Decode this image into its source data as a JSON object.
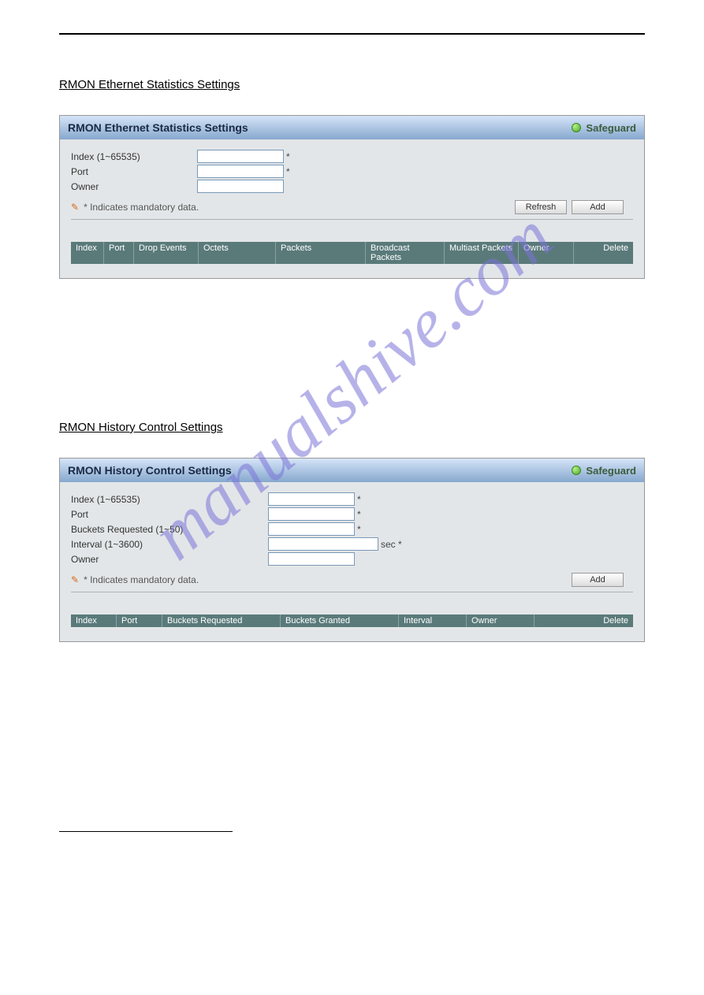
{
  "watermark": "manualshive.com",
  "section1": {
    "title": "RMON Ethernet Statistics Settings",
    "panel_title_pre": "RM",
    "panel_title_post": "ON Ethernet Statistics Settings",
    "safeguard": "Safeguard",
    "fields": {
      "index_label": "Index (1~65535)",
      "port_label": "Port",
      "owner_label": "Owner"
    },
    "star": "*",
    "mandatory": "* Indicates mandatory data.",
    "buttons": {
      "refresh": "Refresh",
      "add": "Add"
    },
    "columns": [
      "Index",
      "Port",
      "Drop Events",
      "Octets",
      "Packets",
      "Broadcast Packets",
      "Multiast Packets",
      "Owner",
      "Delete"
    ]
  },
  "section2": {
    "title": "RMON History Control Settings",
    "panel_title": "RMON History Control Settings",
    "safeguard": "Safeguard",
    "fields": {
      "index_label": "Index (1~65535)",
      "port_label": "Port",
      "buckets_label": "Buckets Requested (1~50)",
      "interval_label": "Interval (1~3600)",
      "interval_suffix": "sec *",
      "owner_label": "Owner"
    },
    "star": "*",
    "mandatory": "* Indicates mandatory data.",
    "buttons": {
      "add": "Add"
    },
    "columns": [
      "Index",
      "Port",
      "Buckets Requested",
      "Buckets Granted",
      "Interval",
      "Owner",
      "Delete"
    ]
  },
  "section3": {
    "title": ""
  }
}
